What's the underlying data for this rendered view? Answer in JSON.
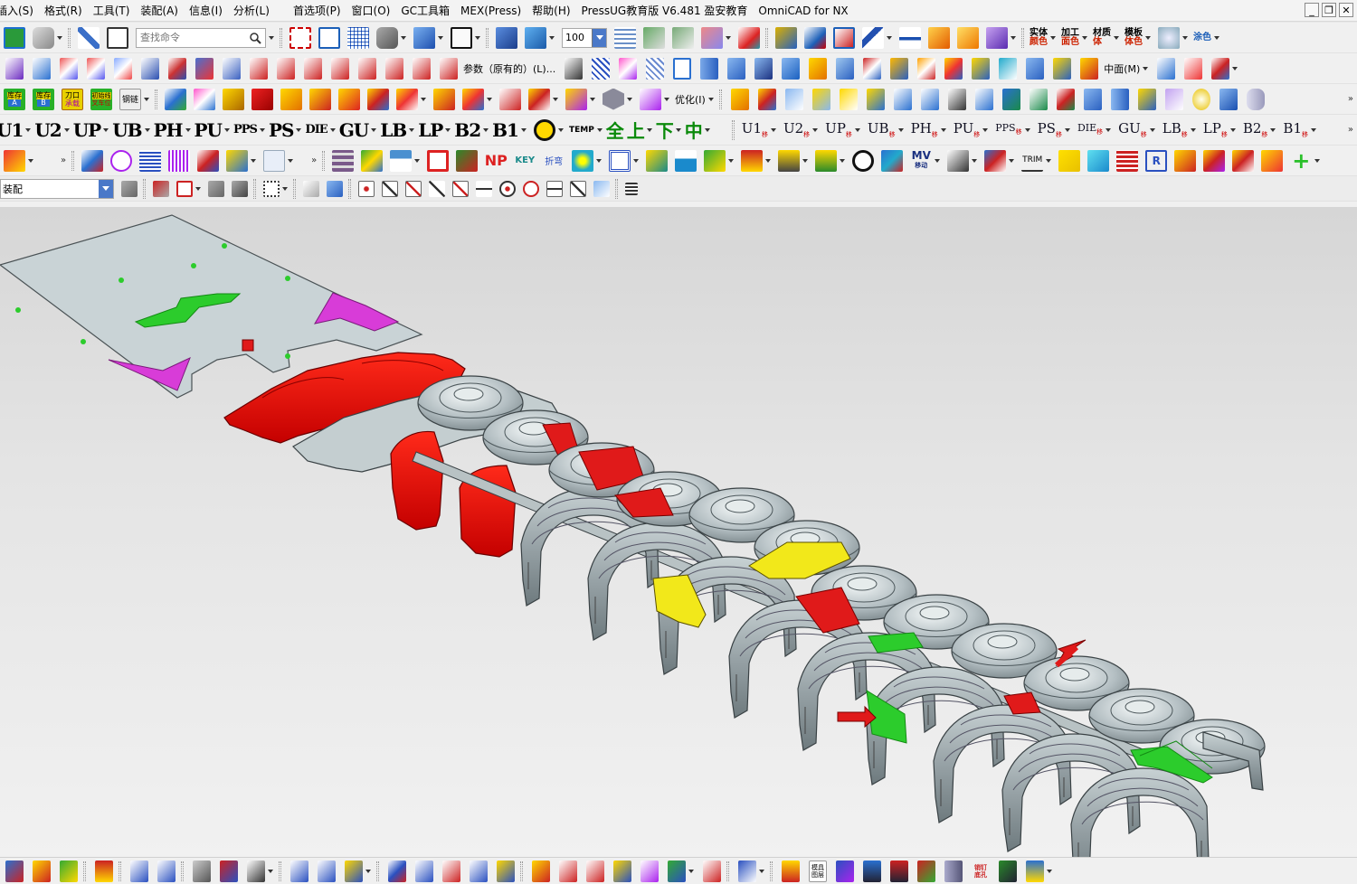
{
  "menubar": {
    "items": [
      "插入(S)",
      "格式(R)",
      "工具(T)",
      "装配(A)",
      "信息(I)",
      "分析(L)",
      "首选项(P)",
      "窗口(O)",
      "GC工具箱",
      "MEX(Press)",
      "帮助(H)",
      "PressUG教育版 V6.481 盈安教育",
      "OmniCAD for NX"
    ],
    "window_controls": {
      "minimize": "_",
      "restore": "❐",
      "close": "✕"
    }
  },
  "toolbar": {
    "search_placeholder": "查找命令",
    "zoom_value": "100",
    "row2_text1": "参数（原有的）(L)...",
    "row2_text2": "中面(M)",
    "row3_small_labels": [
      {
        "top": "库存",
        "bottom": "A"
      },
      {
        "top": "库存",
        "bottom": "B"
      },
      {
        "top": "刀口",
        "bottom": "承载"
      },
      {
        "top": "初始线",
        "bottom": "叉车位"
      },
      {
        "top": "钢链",
        "bottom": ""
      }
    ],
    "row3_optimize": "优化(I)",
    "row1_labels": [
      {
        "top": "实体",
        "bottom": "颜色"
      },
      {
        "top": "加工",
        "bottom": "面色"
      },
      {
        "top": "材质",
        "bottom": "体"
      },
      {
        "top": "模板",
        "bottom": "体色"
      },
      {
        "top": "涂色",
        "bottom": ""
      }
    ],
    "row4_big": [
      "U1",
      "U2",
      "UP",
      "UB",
      "PH",
      "PU",
      "PPS",
      "PS",
      "DIE",
      "GU",
      "LB",
      "LP",
      "B2",
      "B1"
    ],
    "row4_chinese": [
      "TEMP",
      "全",
      "上",
      "下",
      "中"
    ],
    "row4_move": [
      "U1",
      "U2",
      "UP",
      "UB",
      "PH",
      "PU",
      "PPS",
      "PS",
      "DIE",
      "GU",
      "LB",
      "LP",
      "B2",
      "B1"
    ],
    "row4_move_sub": "移",
    "row5_texts": [
      "KEY",
      "折弯",
      "MV",
      "移动",
      "TRIM"
    ],
    "row6_select": "装配"
  },
  "bottombar": {
    "label1": {
      "top": "模具",
      "bottom": "图层"
    },
    "label2": {
      "top": "销钉",
      "bottom": "底孔"
    }
  }
}
